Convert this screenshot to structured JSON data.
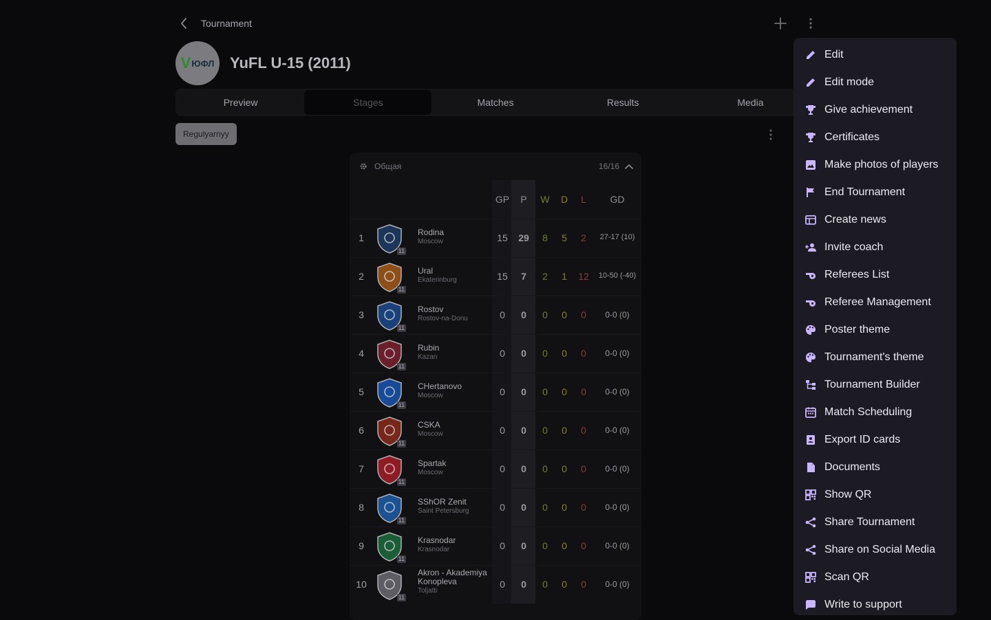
{
  "breadcrumb": {
    "title": "Tournament"
  },
  "tournament": {
    "name": "YuFL U-15 (2011)",
    "logo_text": "ЮФЛ"
  },
  "tabs": [
    {
      "label": "Preview",
      "active": false
    },
    {
      "label": "Stages",
      "active": true
    },
    {
      "label": "Matches",
      "active": false
    },
    {
      "label": "Results",
      "active": false
    },
    {
      "label": "Media",
      "active": false
    }
  ],
  "stage": {
    "chip": "Regulyarnyy"
  },
  "table": {
    "group_name": "Общая",
    "count": "16/16",
    "headers": {
      "gp": "GP",
      "p": "P",
      "w": "W",
      "d": "D",
      "l": "L",
      "gd": "GD"
    },
    "team_badge": "11",
    "rows": [
      {
        "rank": "1",
        "name": "Rodina",
        "city": "Moscow",
        "gp": "15",
        "p": "29",
        "w": "8",
        "d": "5",
        "l": "2",
        "gd": "27-17 (10)",
        "crest": "#1e3d66"
      },
      {
        "rank": "2",
        "name": "Ural",
        "city": "Ekaterinburg",
        "gp": "15",
        "p": "7",
        "w": "2",
        "d": "1",
        "l": "12",
        "gd": "10-50 (-40)",
        "crest": "#a45a18"
      },
      {
        "rank": "3",
        "name": "Rostov",
        "city": "Rostov-na-Donu",
        "gp": "0",
        "p": "0",
        "w": "0",
        "d": "0",
        "l": "0",
        "gd": "0-0 (0)",
        "crest": "#1c4a8c"
      },
      {
        "rank": "4",
        "name": "Rubin",
        "city": "Kazan",
        "gp": "0",
        "p": "0",
        "w": "0",
        "d": "0",
        "l": "0",
        "gd": "0-0 (0)",
        "crest": "#7a2230"
      },
      {
        "rank": "5",
        "name": "CHertanovo",
        "city": "Moscow",
        "gp": "0",
        "p": "0",
        "w": "0",
        "d": "0",
        "l": "0",
        "gd": "0-0 (0)",
        "crest": "#1b55b0"
      },
      {
        "rank": "6",
        "name": "CSKA",
        "city": "Moscow",
        "gp": "0",
        "p": "0",
        "w": "0",
        "d": "0",
        "l": "0",
        "gd": "0-0 (0)",
        "crest": "#8c2a1c"
      },
      {
        "rank": "7",
        "name": "Spartak",
        "city": "Moscow",
        "gp": "0",
        "p": "0",
        "w": "0",
        "d": "0",
        "l": "0",
        "gd": "0-0 (0)",
        "crest": "#a51f27"
      },
      {
        "rank": "8",
        "name": "SShOR Zenit",
        "city": "Saint Petersburg",
        "gp": "0",
        "p": "0",
        "w": "0",
        "d": "0",
        "l": "0",
        "gd": "0-0 (0)",
        "crest": "#1e5ea8"
      },
      {
        "rank": "9",
        "name": "Krasnodar",
        "city": "Krasnodar",
        "gp": "0",
        "p": "0",
        "w": "0",
        "d": "0",
        "l": "0",
        "gd": "0-0 (0)",
        "crest": "#1d6b3c"
      },
      {
        "rank": "10",
        "name": "Akron - Akademiya Konopleva",
        "city": "Toljatti",
        "gp": "0",
        "p": "0",
        "w": "0",
        "d": "0",
        "l": "0",
        "gd": "0-0 (0)",
        "crest": "#6a6a70"
      }
    ]
  },
  "menu": {
    "items": [
      {
        "label": "Edit",
        "icon": "pencil-icon"
      },
      {
        "label": "Edit mode",
        "icon": "pencil-icon"
      },
      {
        "label": "Give achievement",
        "icon": "trophy-icon"
      },
      {
        "label": "Certificates",
        "icon": "trophy-icon"
      },
      {
        "label": "Make photos of players",
        "icon": "image-icon"
      },
      {
        "label": "End Tournament",
        "icon": "flag-icon"
      },
      {
        "label": "Create news",
        "icon": "news-icon"
      },
      {
        "label": "Invite coach",
        "icon": "person-add-icon"
      },
      {
        "label": "Referees List",
        "icon": "whistle-icon"
      },
      {
        "label": "Referee Management",
        "icon": "whistle-icon"
      },
      {
        "label": "Poster theme",
        "icon": "palette-icon"
      },
      {
        "label": "Tournament's theme",
        "icon": "palette-icon"
      },
      {
        "label": "Tournament Builder",
        "icon": "tree-icon"
      },
      {
        "label": "Match Scheduling",
        "icon": "calendar-icon"
      },
      {
        "label": "Export ID cards",
        "icon": "id-card-icon"
      },
      {
        "label": "Documents",
        "icon": "document-icon"
      },
      {
        "label": "Show QR",
        "icon": "qr-icon"
      },
      {
        "label": "Share Tournament",
        "icon": "share-icon"
      },
      {
        "label": "Share on Social Media",
        "icon": "share-icon"
      },
      {
        "label": "Scan QR",
        "icon": "qr-icon"
      },
      {
        "label": "Write to support",
        "icon": "chat-icon"
      }
    ]
  }
}
